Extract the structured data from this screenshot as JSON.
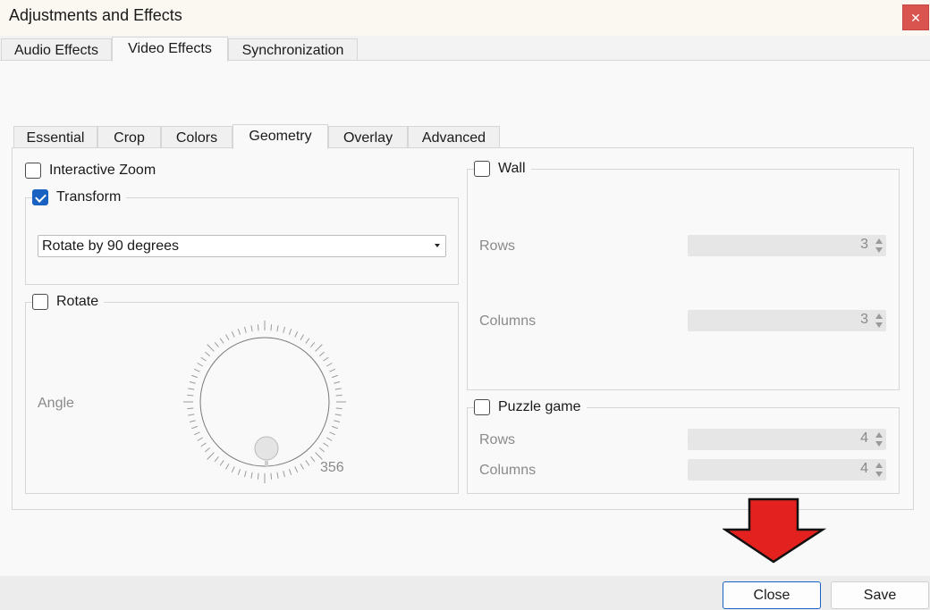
{
  "window": {
    "title": "Adjustments and Effects",
    "close_glyph": "✕"
  },
  "main_tabs": [
    {
      "label": "Audio Effects",
      "active": false
    },
    {
      "label": "Video Effects",
      "active": true
    },
    {
      "label": "Synchronization",
      "active": false
    }
  ],
  "sub_tabs": [
    {
      "label": "Essential",
      "active": false
    },
    {
      "label": "Crop",
      "active": false
    },
    {
      "label": "Colors",
      "active": false
    },
    {
      "label": "Geometry",
      "active": true
    },
    {
      "label": "Overlay",
      "active": false
    },
    {
      "label": "Advanced",
      "active": false
    }
  ],
  "geometry": {
    "interactive_zoom": {
      "label": "Interactive Zoom",
      "checked": false
    },
    "transform": {
      "label": "Transform",
      "checked": true,
      "selected": "Rotate by 90 degrees"
    },
    "rotate": {
      "label": "Rotate",
      "checked": false,
      "angle_label": "Angle",
      "angle_value": "356"
    },
    "wall": {
      "label": "Wall",
      "checked": false,
      "rows_label": "Rows",
      "rows_value": "3",
      "columns_label": "Columns",
      "columns_value": "3"
    },
    "puzzle": {
      "label": "Puzzle game",
      "checked": false,
      "rows_label": "Rows",
      "rows_value": "4",
      "columns_label": "Columns",
      "columns_value": "4"
    }
  },
  "buttons": {
    "close": "Close",
    "save": "Save"
  },
  "colors": {
    "accent": "#1a62c2",
    "close_x_bg": "#d9534f",
    "annotation_arrow": "#e3211f"
  },
  "icons": {
    "annotation": "red-down-arrow-icon",
    "dial": "rotation-dial-icon"
  }
}
